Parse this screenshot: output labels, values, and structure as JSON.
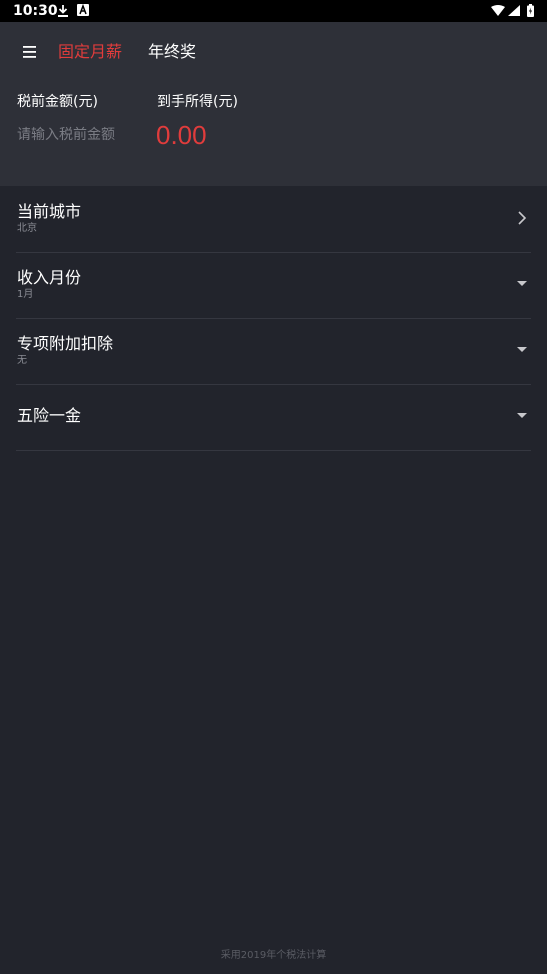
{
  "status_bar": {
    "time": "10:30"
  },
  "header": {
    "tabs": [
      {
        "label": "固定月薪",
        "active": true
      },
      {
        "label": "年终奖",
        "active": false
      }
    ],
    "pretax": {
      "label": "税前金额(元)",
      "placeholder": "请输入税前金额",
      "value": ""
    },
    "net": {
      "label": "到手所得(元)",
      "value": "0.00"
    }
  },
  "list": {
    "city": {
      "title": "当前城市",
      "value": "北京",
      "icon": "chevron-right-icon"
    },
    "month": {
      "title": "收入月份",
      "value": "1月",
      "icon": "dropdown-arrow-icon"
    },
    "deduction": {
      "title": "专项附加扣除",
      "value": "无",
      "icon": "dropdown-arrow-icon"
    },
    "insurance": {
      "title": "五险一金",
      "icon": "dropdown-arrow-icon"
    }
  },
  "footer": {
    "note": "采用2019年个税法计算"
  },
  "colors": {
    "accent": "#e03c3c",
    "background": "#22242c",
    "header_background": "#2e3038",
    "divider": "#353740"
  }
}
